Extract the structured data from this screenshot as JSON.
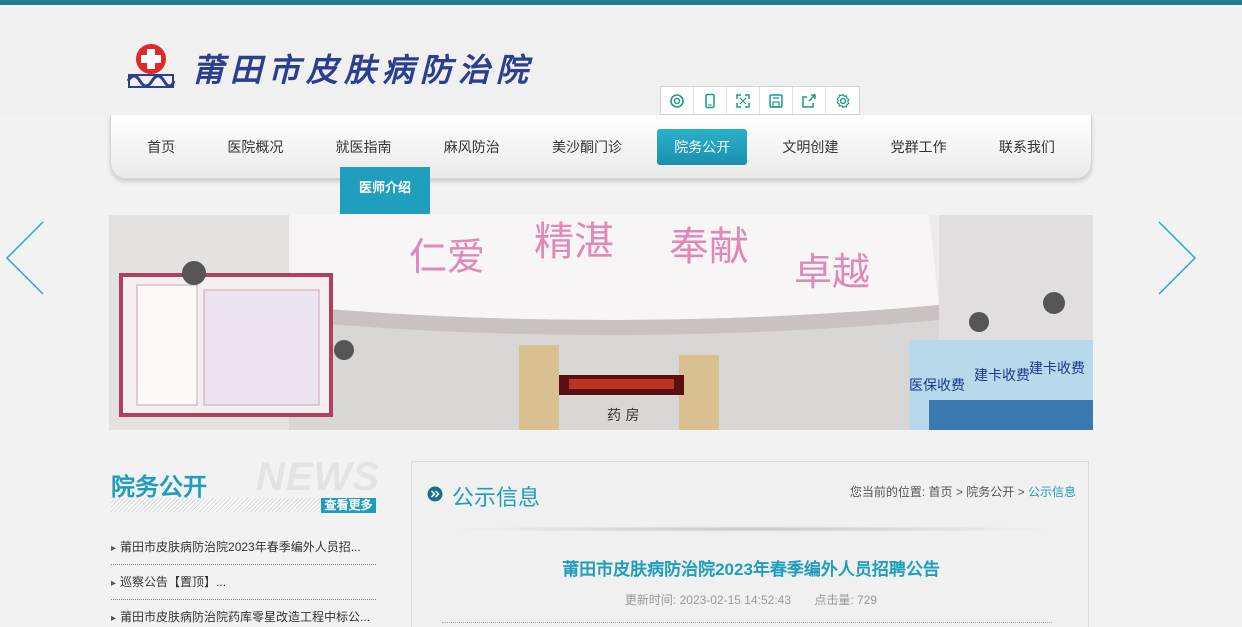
{
  "header": {
    "site_title": "莆田市皮肤病防治院",
    "logo_icon": "hospital-cross-logo"
  },
  "toolbar": {
    "icons": [
      "search-icon",
      "phone-icon",
      "fullscreen-icon",
      "save-icon",
      "share-icon",
      "gear-icon"
    ]
  },
  "nav": {
    "items": [
      "首页",
      "医院概况",
      "就医指南",
      "麻风防治",
      "美沙酮门诊",
      "院务公开",
      "文明创建",
      "党群工作",
      "联系我们"
    ],
    "active_index": 5
  },
  "submenu": {
    "item": "医师介绍"
  },
  "banner": {
    "slogans": [
      "仁爱",
      "精湛",
      "奉献",
      "卓越"
    ],
    "counter_labels": [
      "医保收费",
      "建卡收费",
      "建卡收费"
    ],
    "pharmacy_sign": "药  房"
  },
  "sidebar": {
    "title": "院务公开",
    "watermark": "NEWS",
    "more": "查看更多",
    "items": [
      "莆田市皮肤病防治院2023年春季编外人员招...",
      "巡察公告【置顶】...",
      "莆田市皮肤病防治院药库零星改造工程中标公..."
    ]
  },
  "panel": {
    "title": "公示信息",
    "breadcrumb": {
      "prefix": "您当前的位置:",
      "home": "首页",
      "section": "院务公开",
      "current": "公示信息",
      "sep": ">"
    },
    "article_title": "莆田市皮肤病防治院2023年春季编外人员招聘公告",
    "updated": "更新时间:  2023-02-15 14:52:43",
    "hits": "点击量:  729"
  },
  "colors": {
    "accent": "#1e9dbc",
    "topbar": "#1d7c8e",
    "title_blue": "#2c3f8f",
    "logo_red": "#e02828"
  }
}
